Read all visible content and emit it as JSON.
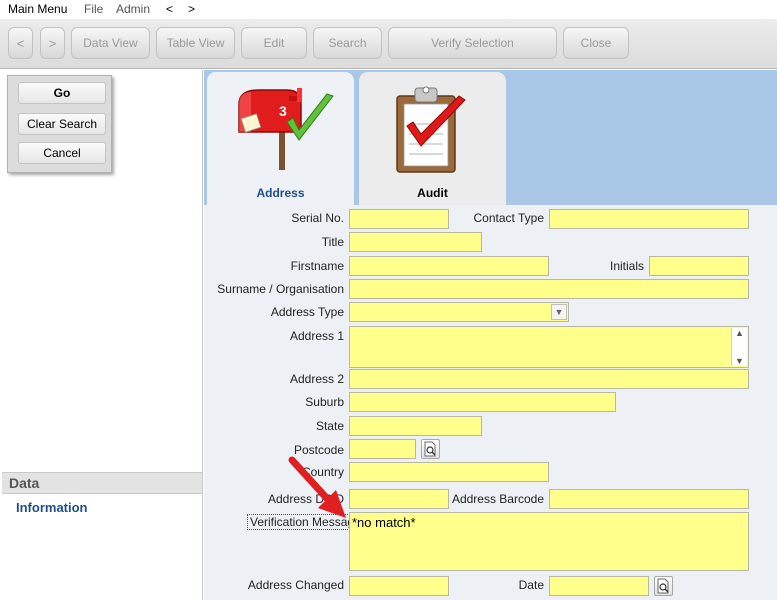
{
  "menubar": {
    "items": [
      "Main Menu",
      "File",
      "Admin",
      "<",
      ">"
    ]
  },
  "toolbar": {
    "back": "<",
    "forward": ">",
    "data_view": "Data View",
    "table_view": "Table View",
    "edit": "Edit",
    "search": "Search",
    "verify_selection": "Verify Selection",
    "close": "Close"
  },
  "actions": {
    "go": "Go",
    "clear_search": "Clear Search",
    "cancel": "Cancel"
  },
  "leftnav": {
    "header": "Data",
    "link": "Information"
  },
  "tabs": {
    "address": "Address",
    "audit": "Audit",
    "mailbox_number": "3"
  },
  "form": {
    "serial_no": {
      "label": "Serial No.",
      "value": ""
    },
    "contact_type": {
      "label": "Contact Type",
      "value": ""
    },
    "title": {
      "label": "Title",
      "value": ""
    },
    "firstname": {
      "label": "Firstname",
      "value": ""
    },
    "initials": {
      "label": "Initials",
      "value": ""
    },
    "surname": {
      "label": "Surname / Organisation",
      "value": ""
    },
    "address_type": {
      "label": "Address Type",
      "value": ""
    },
    "address1": {
      "label": "Address 1",
      "value": ""
    },
    "address2": {
      "label": "Address 2",
      "value": ""
    },
    "suburb": {
      "label": "Suburb",
      "value": ""
    },
    "state": {
      "label": "State",
      "value": ""
    },
    "postcode": {
      "label": "Postcode",
      "value": ""
    },
    "country": {
      "label": "Country",
      "value": ""
    },
    "address_dpid": {
      "label": "Address DPID",
      "value": ""
    },
    "address_barcode": {
      "label": "Address Barcode",
      "value": ""
    },
    "verification_message": {
      "label": "Verification Message",
      "value": "*no match*"
    },
    "address_changed": {
      "label": "Address Changed",
      "value": ""
    },
    "date": {
      "label": "Date",
      "value": ""
    }
  },
  "colors": {
    "field_bg": "#ffff8c",
    "tab_strip": "#a9c8e8",
    "link": "#1f4e8c",
    "annotation_arrow": "#e02020"
  }
}
